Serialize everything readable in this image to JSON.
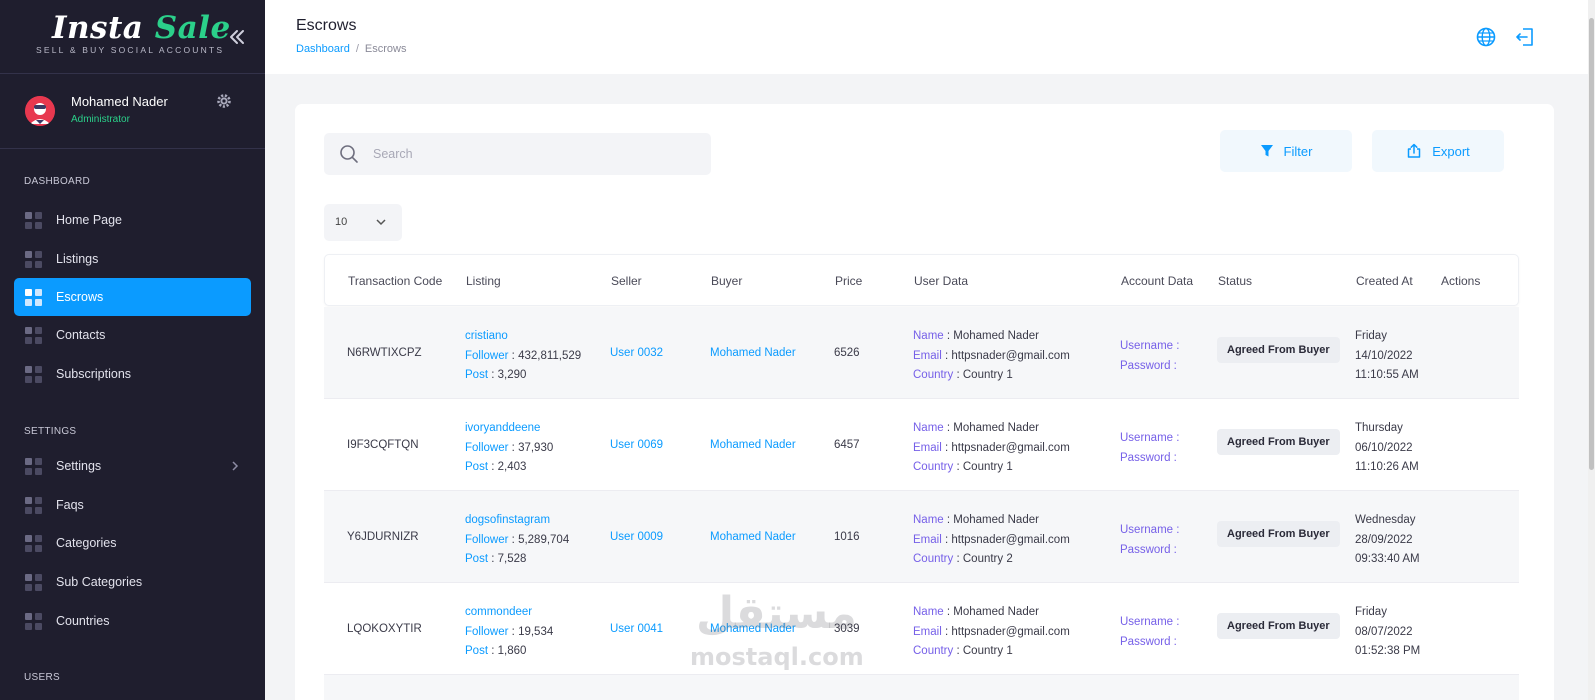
{
  "sidebar": {
    "brand_title_a": "Insta",
    "brand_title_b": "Sale",
    "brand_subtitle": "SELL & BUY SOCIAL ACCOUNTS",
    "profile_name": "Mohamed Nader",
    "profile_role": "Administrator",
    "section_dashboard": "DASHBOARD",
    "section_settings": "SETTINGS",
    "section_users": "USERS",
    "items": [
      {
        "label": "Home Page",
        "active": false
      },
      {
        "label": "Listings",
        "active": false
      },
      {
        "label": "Escrows",
        "active": true
      },
      {
        "label": "Contacts",
        "active": false
      },
      {
        "label": "Subscriptions",
        "active": false
      },
      {
        "label": "Settings",
        "active": false,
        "expandable": true
      },
      {
        "label": "Faqs",
        "active": false
      },
      {
        "label": "Categories",
        "active": false
      },
      {
        "label": "Sub Categories",
        "active": false
      },
      {
        "label": "Countries",
        "active": false
      }
    ]
  },
  "header": {
    "title": "Escrows",
    "breadcrumb_root": "Dashboard",
    "breadcrumb_sep": "/",
    "breadcrumb_current": "Escrows",
    "icons": [
      "globe-icon",
      "logout-icon"
    ]
  },
  "toolbar": {
    "search_placeholder": "Search",
    "filter_label": "Filter",
    "export_label": "Export",
    "page_size": "10"
  },
  "table": {
    "columns": [
      "Transaction Code",
      "Listing",
      "Seller",
      "Buyer",
      "Price",
      "User Data",
      "Account Data",
      "Status",
      "Created At",
      "Actions"
    ],
    "labels": {
      "follower": "Follower",
      "post": "Post",
      "name": "Name",
      "email": "Email",
      "country": "Country",
      "username": "Username :",
      "password": "Password :"
    },
    "rows": [
      {
        "code": "N6RWTIXCPZ",
        "listing": "cristiano",
        "followers": "432,811,529",
        "posts": "3,290",
        "seller": "User 0032",
        "buyer": "Mohamed Nader",
        "price": "6526",
        "name": "Mohamed Nader",
        "email": "httpsnader@gmail.com",
        "country": "Country 1",
        "status": "Agreed From Buyer",
        "day": "Friday",
        "date": "14/10/2022",
        "time": "11:10:55 AM"
      },
      {
        "code": "I9F3CQFTQN",
        "listing": "ivoryanddeene",
        "followers": "37,930",
        "posts": "2,403",
        "seller": "User 0069",
        "buyer": "Mohamed Nader",
        "price": "6457",
        "name": "Mohamed Nader",
        "email": "httpsnader@gmail.com",
        "country": "Country 1",
        "status": "Agreed From Buyer",
        "day": "Thursday",
        "date": "06/10/2022",
        "time": "11:10:26 AM"
      },
      {
        "code": "Y6JDURNIZR",
        "listing": "dogsofinstagram",
        "followers": "5,289,704",
        "posts": "7,528",
        "seller": "User 0009",
        "buyer": "Mohamed Nader",
        "price": "1016",
        "name": "Mohamed Nader",
        "email": "httpsnader@gmail.com",
        "country": "Country 2",
        "status": "Agreed From Buyer",
        "day": "Wednesday",
        "date": "28/09/2022",
        "time": "09:33:40 AM"
      },
      {
        "code": "LQOKOXYTIR",
        "listing": "commondeer",
        "followers": "19,534",
        "posts": "1,860",
        "seller": "User 0041",
        "buyer": "Mohamed Nader",
        "price": "3039",
        "name": "Mohamed Nader",
        "email": "httpsnader@gmail.com",
        "country": "Country 1",
        "status": "Agreed From Buyer",
        "day": "Friday",
        "date": "08/07/2022",
        "time": "01:52:38 PM"
      }
    ]
  },
  "watermark": {
    "arabic": "مستقل",
    "latin": "mostaql.com"
  },
  "colors": {
    "sidebar_bg": "#1f1e2e",
    "accent_blue": "#0b9bff",
    "brand_green": "#2bd08a",
    "label_purple": "#7660e8"
  }
}
